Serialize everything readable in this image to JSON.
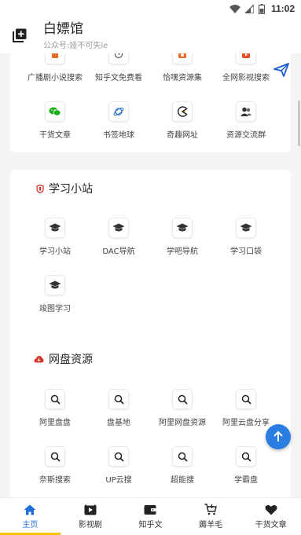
{
  "status_bar": {
    "time": "11:02"
  },
  "header": {
    "title": "白嫖馆",
    "subtitle": "公众号:娅不可失le"
  },
  "colors": {
    "accent": "#1e6fd9",
    "tab_indicator": "#f5c400",
    "fab": "#2a7de1"
  },
  "top_section": {
    "row1": [
      {
        "label": "广播剧小说搜索",
        "icon": "book-icon"
      },
      {
        "label": "知乎文免费看",
        "icon": "clock-icon"
      },
      {
        "label": "恰嘿资源集",
        "icon": "camera-icon"
      },
      {
        "label": "全网影视搜索",
        "icon": "video-icon"
      }
    ],
    "row2": [
      {
        "label": "干货文章",
        "icon": "wechat-icon"
      },
      {
        "label": "书签地球",
        "icon": "planet-icon"
      },
      {
        "label": "奇趣网址",
        "icon": "pacman-icon"
      },
      {
        "label": "资源交流群",
        "icon": "group-icon"
      }
    ]
  },
  "study_section": {
    "title": "学习小站",
    "items": [
      {
        "label": "学习小站",
        "icon": "graduation-cap-icon"
      },
      {
        "label": "DAC导航",
        "icon": "graduation-cap-icon"
      },
      {
        "label": "学吧导航",
        "icon": "graduation-cap-icon"
      },
      {
        "label": "学习口袋",
        "icon": "graduation-cap-icon"
      },
      {
        "label": "竣图学习",
        "icon": "graduation-cap-icon"
      }
    ]
  },
  "cloud_section": {
    "title": "网盘资源",
    "items": [
      {
        "label": "阿里盘盘",
        "icon": "search-icon"
      },
      {
        "label": "盘基地",
        "icon": "search-icon"
      },
      {
        "label": "阿里网盘资源",
        "icon": "search-icon"
      },
      {
        "label": "阿里云盘分享",
        "icon": "search-icon"
      },
      {
        "label": "奈斯搜索",
        "icon": "search-icon"
      },
      {
        "label": "UP云搜",
        "icon": "search-icon"
      },
      {
        "label": "超能搜",
        "icon": "search-icon"
      },
      {
        "label": "学霸盘",
        "icon": "search-icon"
      }
    ]
  },
  "tabs": [
    {
      "label": "主页",
      "icon": "home-icon",
      "active": true
    },
    {
      "label": "影视剧",
      "icon": "play-icon",
      "active": false
    },
    {
      "label": "知乎文",
      "icon": "wallet-icon",
      "active": false
    },
    {
      "label": "薅羊毛",
      "icon": "cart-icon",
      "active": false
    },
    {
      "label": "干货文章",
      "icon": "heart-icon",
      "active": false
    }
  ]
}
